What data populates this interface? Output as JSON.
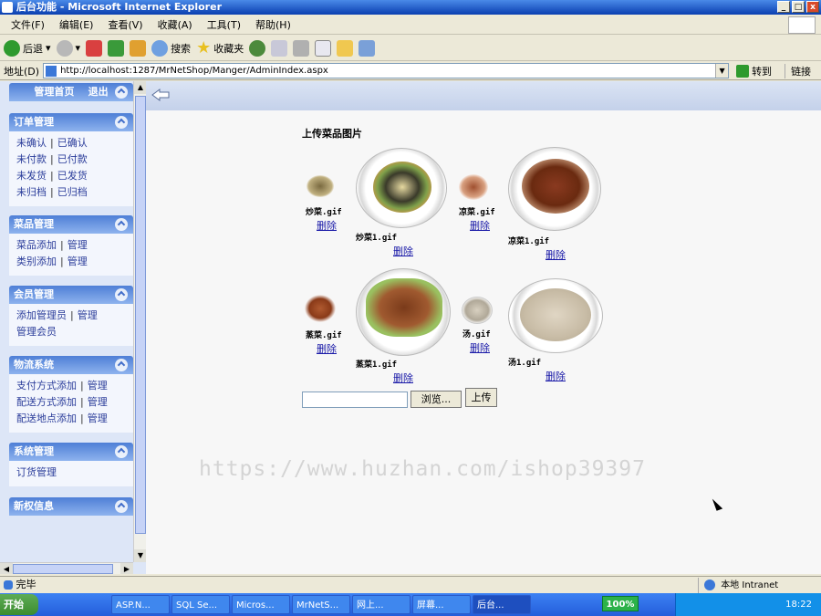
{
  "window": {
    "title": "后台功能 - Microsoft Internet Explorer",
    "btn_min": "_",
    "btn_max": "□",
    "btn_close": "x"
  },
  "menu": [
    "文件(F)",
    "编辑(E)",
    "查看(V)",
    "收藏(A)",
    "工具(T)",
    "帮助(H)"
  ],
  "toolbar": {
    "back": "后退",
    "search": "搜索",
    "favorites": "收藏夹"
  },
  "address": {
    "label": "地址(D)",
    "url": "http://localhost:1287/MrNetShop/Manger/AdminIndex.aspx",
    "go": "转到",
    "links": "链接"
  },
  "sidebar": {
    "top": {
      "home": "管理首页",
      "logout": "退出"
    },
    "sections": [
      {
        "title": "订单管理",
        "rows": [
          [
            "未确认",
            "已确认"
          ],
          [
            "未付款",
            "已付款"
          ],
          [
            "未发货",
            "已发货"
          ],
          [
            "未归档",
            "已归档"
          ]
        ]
      },
      {
        "title": "菜品管理",
        "rows": [
          [
            "菜品添加",
            "管理"
          ],
          [
            "类别添加",
            "管理"
          ]
        ]
      },
      {
        "title": "会员管理",
        "rows": [
          [
            "添加管理员",
            "管理"
          ],
          [
            "管理会员"
          ]
        ]
      },
      {
        "title": "物流系统",
        "rows": [
          [
            "支付方式添加",
            "管理"
          ],
          [
            "配送方式添加",
            "管理"
          ],
          [
            "配送地点添加",
            "管理"
          ]
        ]
      },
      {
        "title": "系统管理",
        "rows": [
          [
            "订货管理"
          ]
        ]
      },
      {
        "title": "新权信息",
        "rows": []
      }
    ]
  },
  "main": {
    "title": "上传菜品图片",
    "delete_label": "删除",
    "images": [
      {
        "name": "炒菜.gif"
      },
      {
        "name": "炒菜1.gif"
      },
      {
        "name": "凉菜.gif"
      },
      {
        "name": "凉菜1.gif"
      },
      {
        "name": "蒸菜.gif"
      },
      {
        "name": "蒸菜1.gif"
      },
      {
        "name": "汤.gif"
      },
      {
        "name": "汤1.gif"
      }
    ],
    "browse": "浏览...",
    "upload": "上传"
  },
  "watermark": "https://www.huzhan.com/ishop39397",
  "status": {
    "text": "完毕",
    "zone": "本地 Intranet"
  },
  "taskbar": {
    "start": "开始",
    "tasks": [
      "ASP.N...",
      "SQL Se...",
      "Micros...",
      "MrNetS...",
      "网上...",
      "屏幕...",
      "后台..."
    ],
    "ime": "100%",
    "clock": "18:22"
  }
}
